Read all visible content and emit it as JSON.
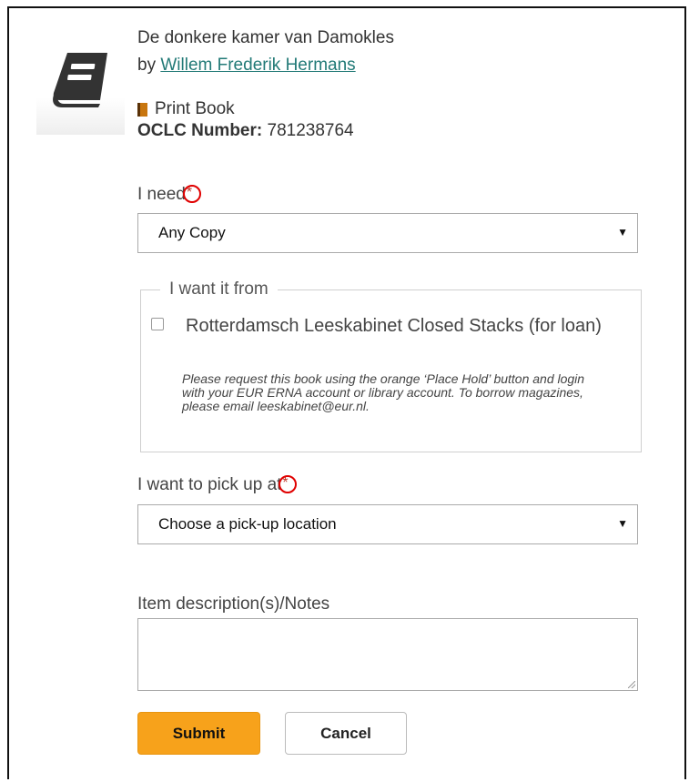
{
  "record": {
    "title": "De donkere kamer van Damokles",
    "by_prefix": "by ",
    "author": "Willem Frederik Hermans",
    "format": "Print Book",
    "oclc_label": "OCLC Number:",
    "oclc_value": "781238764",
    "thumbnail_icon": "book-icon"
  },
  "form": {
    "required_marker": "*",
    "need": {
      "label": "I need",
      "selected": "Any Copy"
    },
    "source": {
      "legend": "I want it from",
      "location_label": "Rotterdamsch Leeskabinet Closed Stacks (for loan)",
      "location_note": "Please request this book using the orange ‘Place Hold’ button and login with your EUR ERNA account or library account. To borrow magazines, please email leeskabinet@eur.nl.",
      "checked": false
    },
    "pickup": {
      "label": "I want to pick up at",
      "selected": "Choose a pick-up location"
    },
    "notes": {
      "label": "Item description(s)/Notes",
      "value": ""
    },
    "submit_label": "Submit",
    "cancel_label": "Cancel"
  },
  "colors": {
    "accent": "#f7a21b",
    "link": "#227a77",
    "annotation": "#e00000"
  }
}
